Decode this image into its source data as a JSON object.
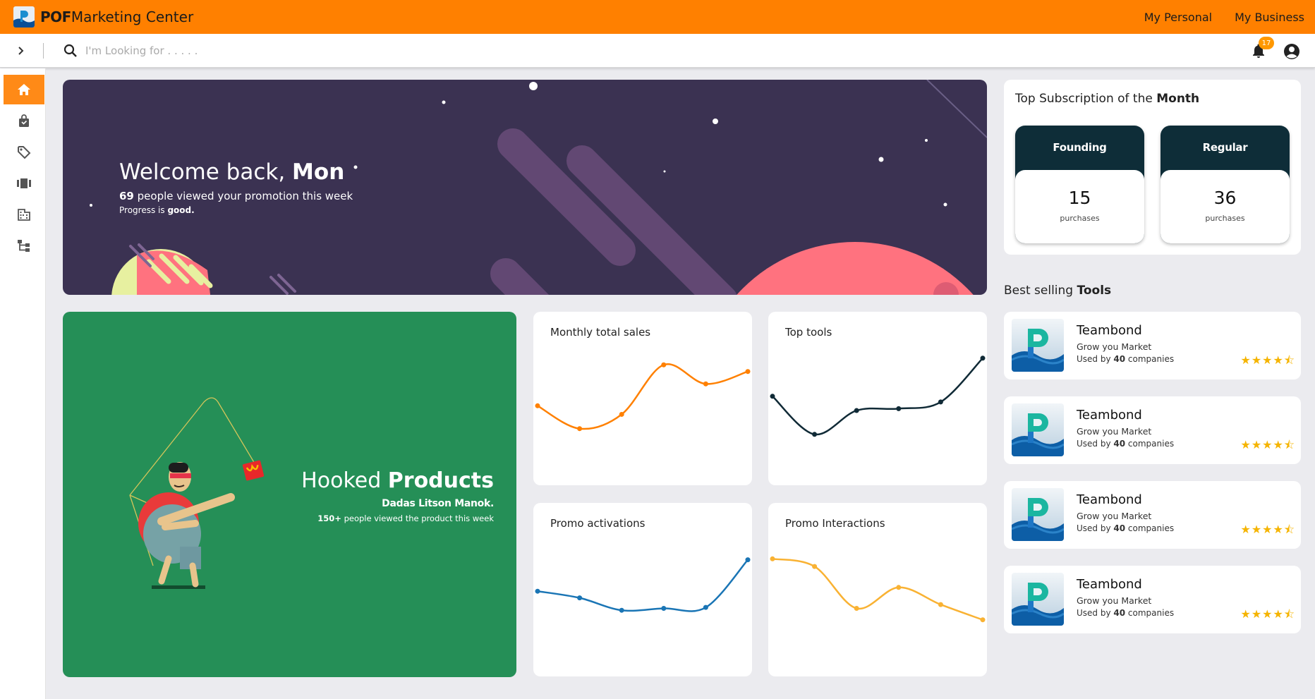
{
  "app": {
    "title_bold": "POF",
    "title_rest": "Marketing Center",
    "nav_links": [
      "My Personal",
      "My Business"
    ]
  },
  "search": {
    "placeholder": "I'm Looking for . . . . ."
  },
  "notifications": {
    "count": "17"
  },
  "sidebar": {
    "items": [
      {
        "icon": "home-icon",
        "active": true
      },
      {
        "icon": "shopping-bag-icon",
        "active": false
      },
      {
        "icon": "tag-icon",
        "active": false
      },
      {
        "icon": "carousel-icon",
        "active": false
      },
      {
        "icon": "building-icon",
        "active": false
      },
      {
        "icon": "hierarchy-icon",
        "active": false
      }
    ]
  },
  "hero": {
    "greeting": "Welcome back, ",
    "user_name": "Mon",
    "views_count": "69",
    "views_text": " people viewed your promotion this week",
    "progress_text": "Progress is ",
    "progress_value": "good."
  },
  "promo": {
    "title_light": "Hooked ",
    "title_bold": "Products",
    "name": "Dadas Litson Manok.",
    "views_count": "150+",
    "views_text": " people viewed the product this week"
  },
  "chart_data": [
    {
      "type": "line",
      "title": "Monthly total sales",
      "x": [
        1,
        2,
        3,
        4,
        5,
        6
      ],
      "series": [
        {
          "values": [
            42,
            18,
            33,
            85,
            65,
            78
          ]
        }
      ],
      "ylim": [
        0,
        100
      ],
      "color": "#ff8000",
      "grid": false
    },
    {
      "type": "line",
      "title": "Top tools",
      "x": [
        1,
        2,
        3,
        4,
        5,
        6
      ],
      "series": [
        {
          "values": [
            52,
            12,
            37,
            39,
            46,
            92
          ]
        }
      ],
      "ylim": [
        0,
        100
      ],
      "color": "#102a36",
      "grid": false
    },
    {
      "type": "line",
      "title": "Promo activations",
      "x": [
        1,
        2,
        3,
        4,
        5,
        6
      ],
      "series": [
        {
          "values": [
            48,
            41,
            28,
            30,
            31,
            81
          ]
        }
      ],
      "ylim": [
        0,
        100
      ],
      "color": "#1a75b5",
      "grid": false
    },
    {
      "type": "line",
      "title": "Promo Interactions",
      "x": [
        1,
        2,
        3,
        4,
        5,
        6
      ],
      "series": [
        {
          "values": [
            82,
            74,
            30,
            52,
            34,
            18
          ]
        }
      ],
      "ylim": [
        0,
        100
      ],
      "color": "#f9b233",
      "grid": false
    }
  ],
  "subscriptions": {
    "title_light": "Top Subscription of the ",
    "title_bold": "Month",
    "tiers": [
      {
        "name": "Founding",
        "count": "15",
        "unit": "purchases"
      },
      {
        "name": "Regular",
        "count": "36",
        "unit": "purchases"
      }
    ]
  },
  "best_selling": {
    "title_light": "Best selling ",
    "title_bold": "Tools",
    "tools": [
      {
        "name": "Teambond",
        "desc": "Grow you Market",
        "usage_prefix": "Used by ",
        "usage_count": "40",
        "usage_suffix": " companies",
        "rating": 4.5
      },
      {
        "name": "Teambond",
        "desc": "Grow you Market",
        "usage_prefix": "Used by ",
        "usage_count": "40",
        "usage_suffix": " companies",
        "rating": 4.5
      },
      {
        "name": "Teambond",
        "desc": "Grow you Market",
        "usage_prefix": "Used by ",
        "usage_count": "40",
        "usage_suffix": " companies",
        "rating": 4.5
      },
      {
        "name": "Teambond",
        "desc": "Grow you Market",
        "usage_prefix": "Used by ",
        "usage_count": "40",
        "usage_suffix": " companies",
        "rating": 4.5
      }
    ]
  },
  "colors": {
    "brand": "#ff8000",
    "hero_bg": "#3b3252",
    "promo_bg": "#258f57",
    "tier_header": "#0e2d38",
    "star": "#f5b400"
  }
}
